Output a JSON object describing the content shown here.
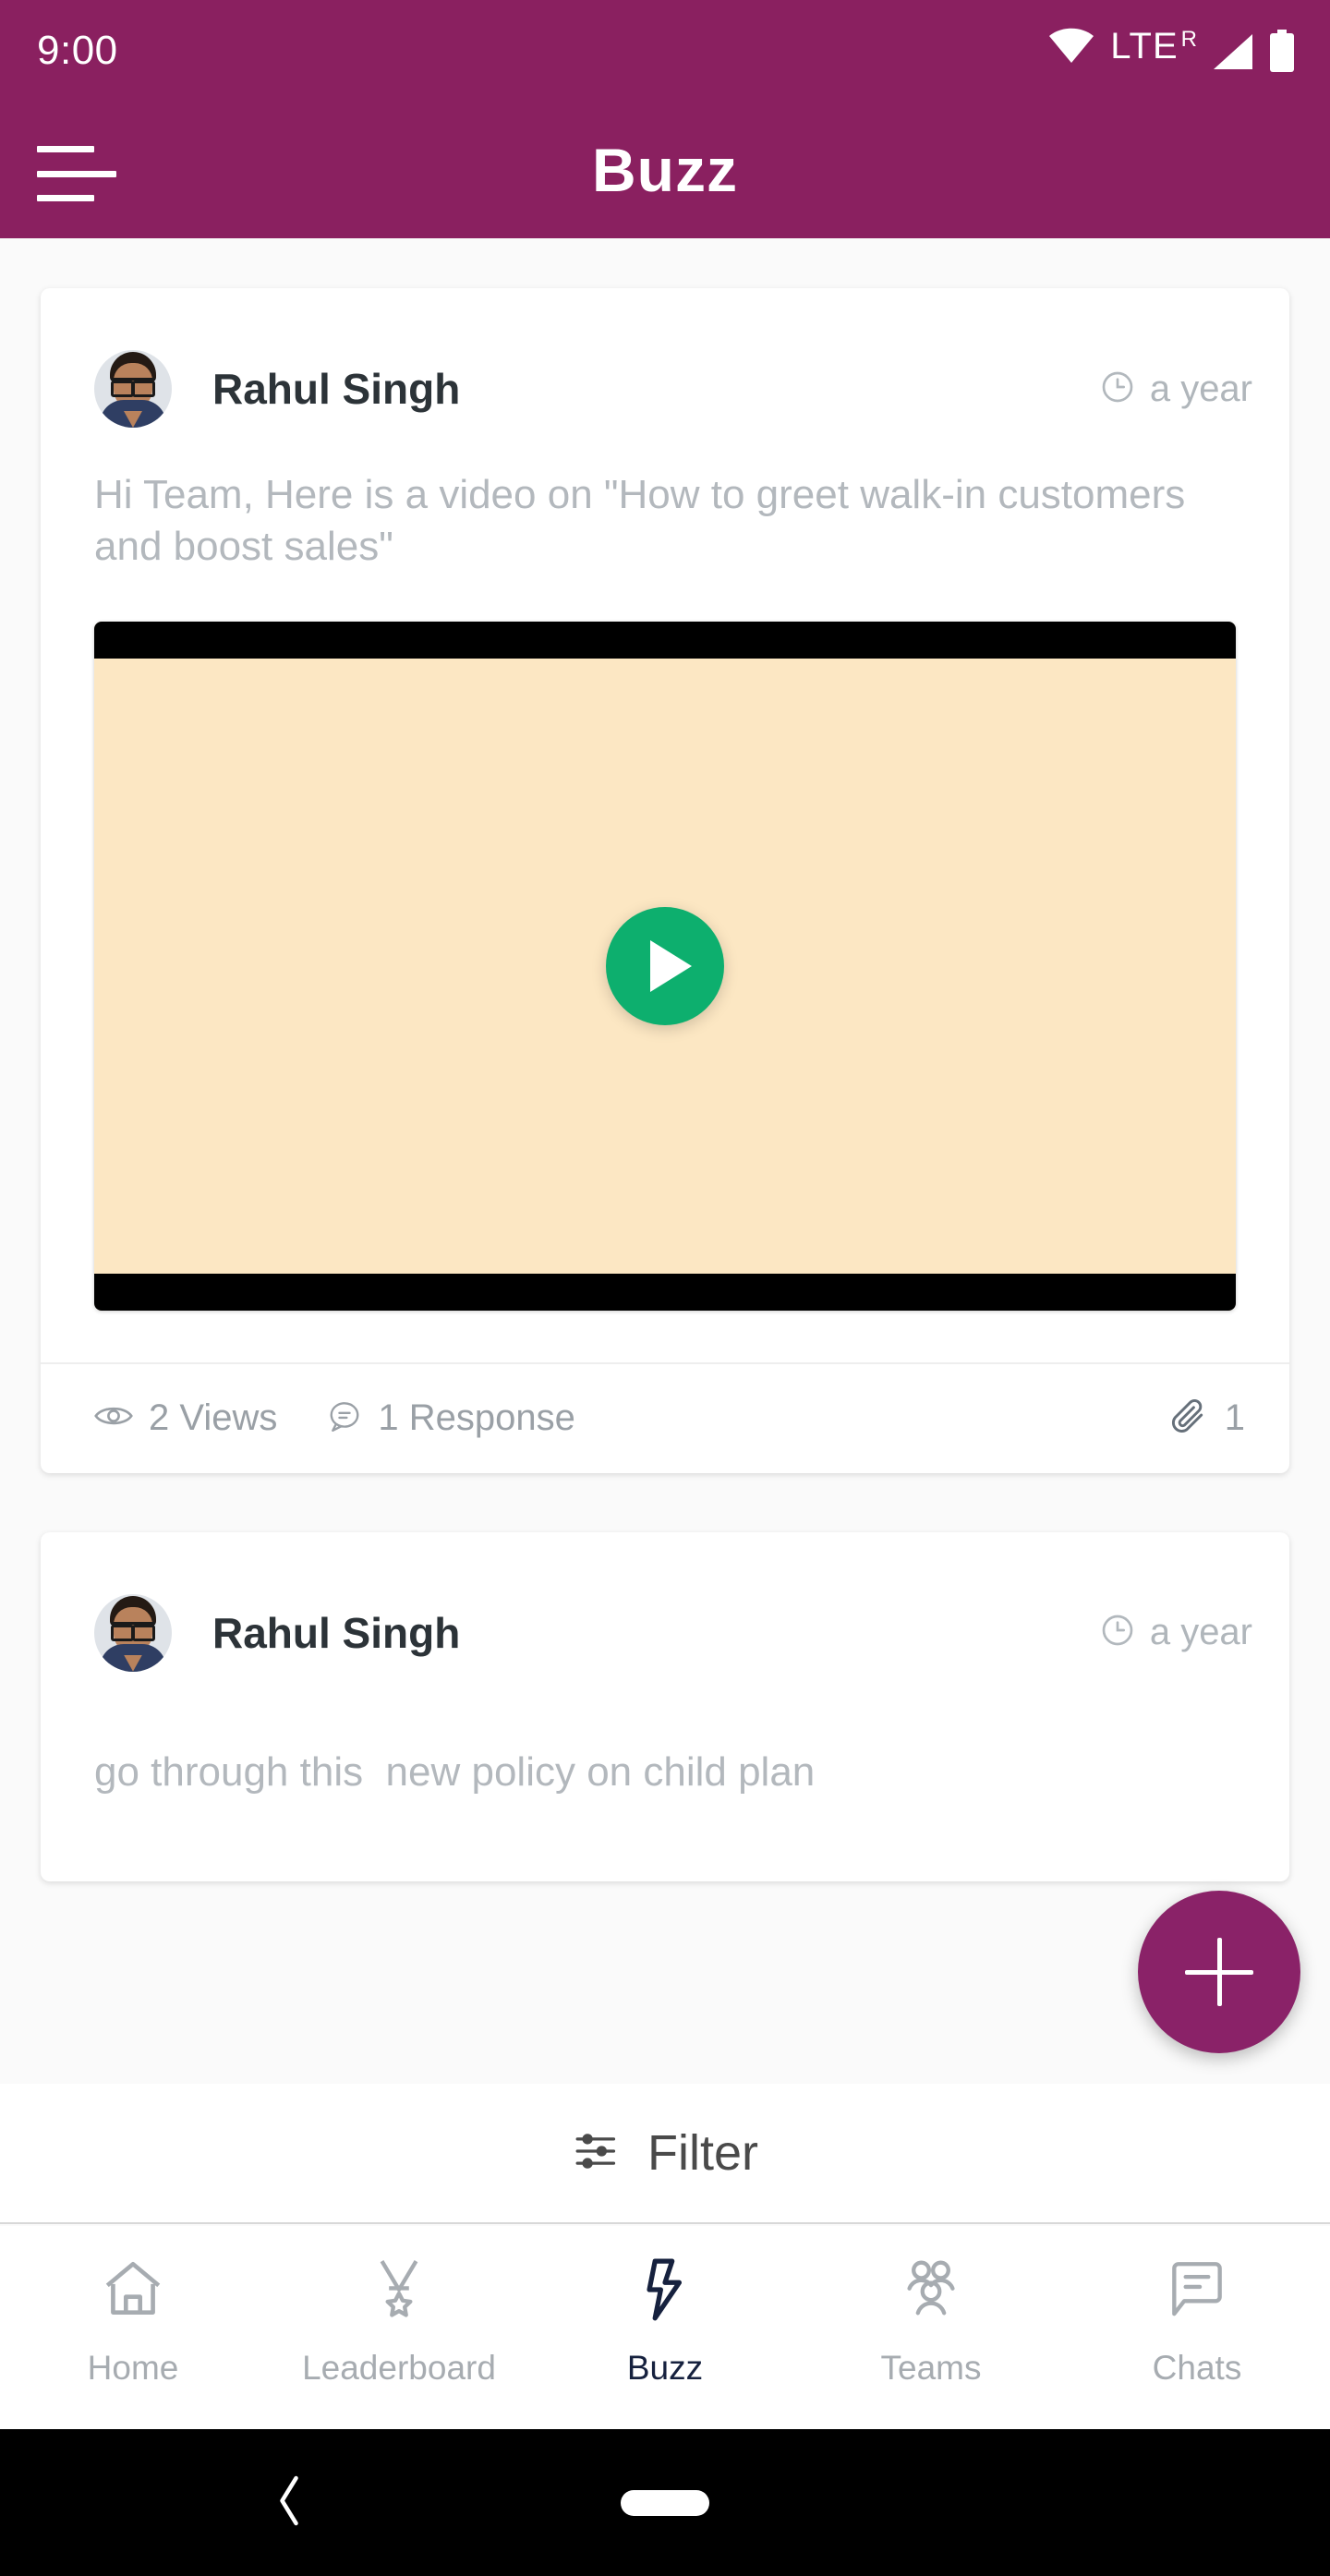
{
  "status_bar": {
    "time": "9:00",
    "network_label": "LTE",
    "network_superscript": "R",
    "icons": [
      "wifi-icon",
      "signal-icon",
      "battery-icon"
    ]
  },
  "app_bar": {
    "title": "Buzz",
    "menu_icon": "hamburger-menu-icon",
    "background_color": "#8a2060"
  },
  "posts": [
    {
      "author": "Rahul Singh",
      "timestamp": "a year",
      "text": "Hi Team, Here is a video on \"How to greet walk-in customers and boost sales\"",
      "media": {
        "type": "video",
        "play_icon": "play-icon",
        "play_button_color": "#0daf6e",
        "thumbnail_color": "#fce7c3"
      },
      "views_label": "2 Views",
      "responses_label": "1 Response",
      "attachment_count": "1"
    },
    {
      "author": "Rahul Singh",
      "timestamp": "a year",
      "text": "go through this  new policy on child plan"
    }
  ],
  "fab": {
    "label": "+",
    "icon": "plus-icon",
    "color": "#8a2268"
  },
  "filter_bar": {
    "label": "Filter",
    "icon": "filter-sliders-icon"
  },
  "bottom_nav": {
    "active": "Buzz",
    "active_color": "#16213e",
    "inactive_color": "#a7acb1",
    "items": [
      {
        "label": "Home",
        "icon": "home-icon"
      },
      {
        "label": "Leaderboard",
        "icon": "medal-icon"
      },
      {
        "label": "Buzz",
        "icon": "lightning-bolt-icon"
      },
      {
        "label": "Teams",
        "icon": "people-group-icon"
      },
      {
        "label": "Chats",
        "icon": "chat-bubble-icon"
      }
    ]
  },
  "system_nav": {
    "back_icon": "back-chevron-icon",
    "home_icon": "home-pill-icon"
  }
}
